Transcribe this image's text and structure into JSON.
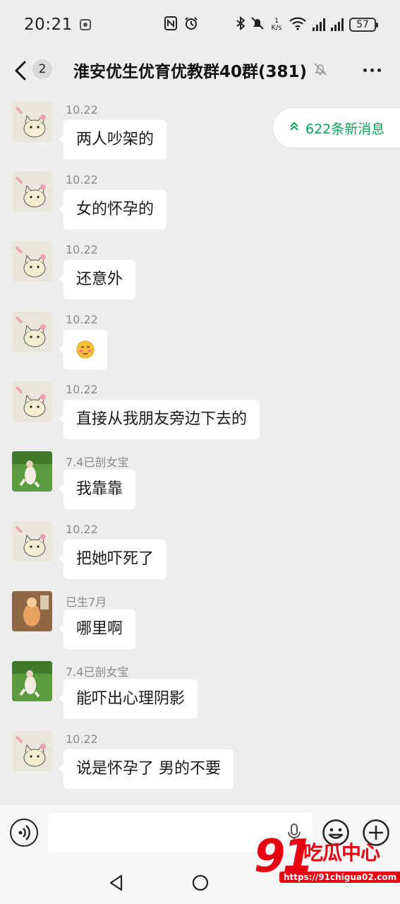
{
  "status_bar": {
    "time": "20:21",
    "net_speed_top": "1",
    "net_speed_bottom": "K/s",
    "battery": "57"
  },
  "header": {
    "unread_count": "2",
    "title": "淮安优生优育优教群40群(381)"
  },
  "new_messages": {
    "label": "622条新消息"
  },
  "messages": [
    {
      "sender": "10.22",
      "text": "两人吵架的",
      "avatar": "cat"
    },
    {
      "sender": "10.22",
      "text": "女的怀孕的",
      "avatar": "cat"
    },
    {
      "sender": "10.22",
      "text": "还意外",
      "avatar": "cat"
    },
    {
      "sender": "10.22",
      "text": "",
      "avatar": "cat",
      "emoji": "blushing-face-emoji"
    },
    {
      "sender": "10.22",
      "text": "直接从我朋友旁边下去的",
      "avatar": "cat"
    },
    {
      "sender": "7.4已剖女宝",
      "text": "我靠靠",
      "avatar": "green"
    },
    {
      "sender": "10.22",
      "text": "把她吓死了",
      "avatar": "cat"
    },
    {
      "sender": "已生7月",
      "text": "哪里啊",
      "avatar": "brown"
    },
    {
      "sender": "7.4已剖女宝",
      "text": "能吓出心理阴影",
      "avatar": "green"
    },
    {
      "sender": "10.22",
      "text": "说是怀孕了 男的不要",
      "avatar": "cat"
    }
  ],
  "input_bar": {
    "placeholder": ""
  },
  "watermark": {
    "logo_number": "91",
    "logo_name": "吃瓜中心",
    "url": "https://91chigua02.com"
  },
  "colors": {
    "background": "#ededed",
    "bubble": "#ffffff",
    "accent_green": "#07a35a",
    "watermark_red": "#e60012"
  }
}
